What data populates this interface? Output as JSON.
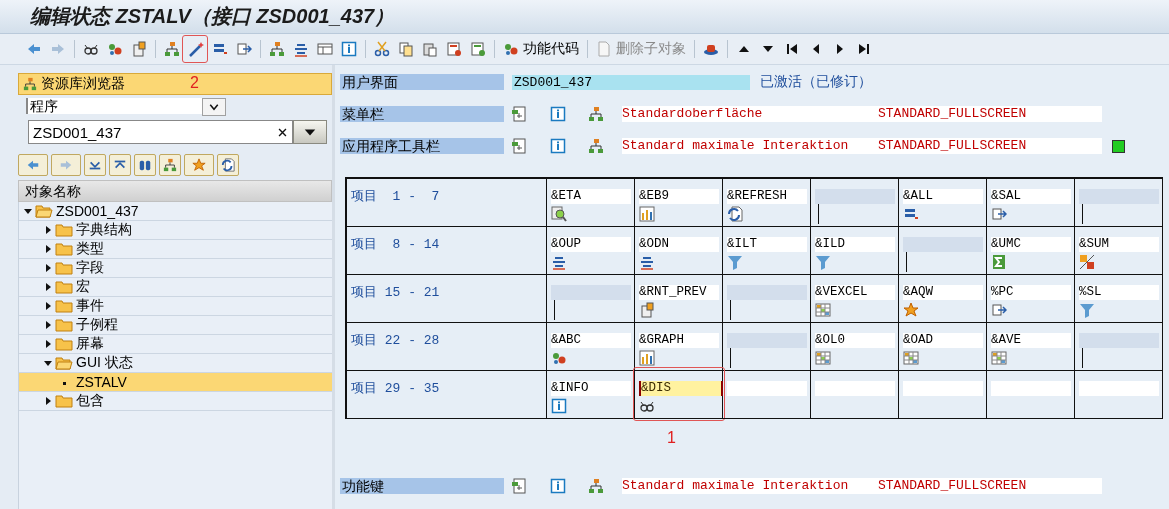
{
  "window": {
    "title": "编辑状态 ZSTALV（接口 ZSD001_437）"
  },
  "toolbar": {
    "function_code_button": {
      "label": "功能代码",
      "disabled": false
    },
    "delete_button": {
      "label": "删除子对象",
      "disabled": true
    },
    "annotation": "2"
  },
  "browser": {
    "title": "资源库浏览器",
    "object_type": "程序",
    "object_name": "ZSD001_437",
    "column_header": "对象名称",
    "tree": [
      {
        "label": "ZSD001_437",
        "kind": "folder",
        "expanded": true,
        "selected": false,
        "children": [
          {
            "label": "字典结构",
            "kind": "folder",
            "expanded": false,
            "selected": false
          },
          {
            "label": "类型",
            "kind": "folder",
            "expanded": false,
            "selected": false
          },
          {
            "label": "字段",
            "kind": "folder",
            "expanded": false,
            "selected": false
          },
          {
            "label": "宏",
            "kind": "folder",
            "expanded": false,
            "selected": false
          },
          {
            "label": "事件",
            "kind": "folder",
            "expanded": false,
            "selected": false
          },
          {
            "label": "子例程",
            "kind": "folder",
            "expanded": false,
            "selected": false
          },
          {
            "label": "屏幕",
            "kind": "folder",
            "expanded": false,
            "selected": false
          },
          {
            "label": "GUI 状态",
            "kind": "folder",
            "expanded": true,
            "selected": false,
            "children": [
              {
                "label": "ZSTALV",
                "kind": "leaf",
                "selected": true
              }
            ]
          },
          {
            "label": "包含",
            "kind": "folder",
            "expanded": false,
            "selected": false
          }
        ]
      }
    ]
  },
  "interface": {
    "label": "用户界面",
    "value": "ZSD001_437",
    "status": "已激活（已修订）"
  },
  "menu_bar": {
    "label": "菜单栏",
    "texts": [
      "Standardoberfläche",
      "STANDARD_FULLSCREEN"
    ]
  },
  "app_toolbar": {
    "label": "应用程序工具栏",
    "texts": [
      "Standard maximale Interaktion",
      "STANDARD_FULLSCREEN"
    ],
    "status_light": true
  },
  "items_grid": {
    "rows": [
      {
        "label": "项目  1 -  7",
        "cells": [
          {
            "kind": "function",
            "code": "&ETA",
            "selected": false
          },
          {
            "kind": "function",
            "code": "&EB9",
            "selected": false
          },
          {
            "kind": "function",
            "code": "&REFRESH",
            "selected": false
          },
          {
            "kind": "placeholder",
            "selected": false
          },
          {
            "kind": "function",
            "code": "&ALL",
            "selected": false
          },
          {
            "kind": "function",
            "code": "&SAL",
            "selected": false
          },
          {
            "kind": "placeholder",
            "selected": false
          }
        ]
      },
      {
        "label": "项目  8 - 14",
        "cells": [
          {
            "kind": "function",
            "code": "&OUP",
            "selected": false
          },
          {
            "kind": "function",
            "code": "&ODN",
            "selected": false
          },
          {
            "kind": "function",
            "code": "&ILT",
            "selected": false
          },
          {
            "kind": "function",
            "code": "&ILD",
            "selected": false
          },
          {
            "kind": "placeholder",
            "selected": false
          },
          {
            "kind": "function",
            "code": "&UMC",
            "selected": false
          },
          {
            "kind": "function",
            "code": "&SUM",
            "selected": false
          }
        ]
      },
      {
        "label": "项目 15 - 21",
        "cells": [
          {
            "kind": "placeholder",
            "selected": false
          },
          {
            "kind": "function",
            "code": "&RNT_PREV",
            "selected": false
          },
          {
            "kind": "placeholder",
            "selected": false
          },
          {
            "kind": "function",
            "code": "&VEXCEL",
            "selected": false
          },
          {
            "kind": "function",
            "code": "&AQW",
            "selected": false
          },
          {
            "kind": "function",
            "code": "%PC",
            "selected": false
          },
          {
            "kind": "function",
            "code": "%SL",
            "selected": false
          }
        ]
      },
      {
        "label": "项目 22 - 28",
        "cells": [
          {
            "kind": "function",
            "code": "&ABC",
            "selected": false
          },
          {
            "kind": "function",
            "code": "&GRAPH",
            "selected": false
          },
          {
            "kind": "placeholder",
            "selected": false
          },
          {
            "kind": "function",
            "code": "&OL0",
            "selected": false
          },
          {
            "kind": "function",
            "code": "&OAD",
            "selected": false
          },
          {
            "kind": "function",
            "code": "&AVE",
            "selected": false
          },
          {
            "kind": "placeholder",
            "selected": false
          }
        ]
      },
      {
        "label": "项目 29 - 35",
        "cells": [
          {
            "kind": "function",
            "code": "&INFO",
            "selected": false
          },
          {
            "kind": "function",
            "code": "&DIS",
            "selected": true,
            "annotation": "1"
          },
          {
            "kind": "empty",
            "selected": false
          },
          {
            "kind": "empty",
            "selected": false
          },
          {
            "kind": "empty",
            "selected": false
          },
          {
            "kind": "empty",
            "selected": false
          },
          {
            "kind": "empty",
            "selected": false
          }
        ]
      }
    ]
  },
  "function_keys": {
    "label": "功能键",
    "texts": [
      "Standard maximale Interaktion",
      "STANDARD_FULLSCREEN"
    ]
  }
}
